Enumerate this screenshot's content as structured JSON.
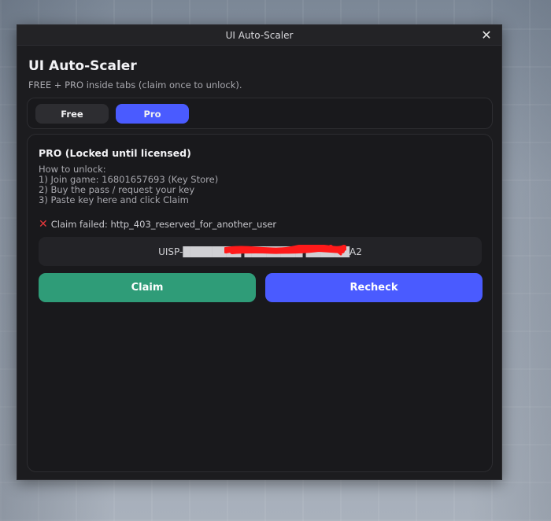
{
  "window": {
    "title": "UI Auto-Scaler",
    "close_glyph": "✕"
  },
  "app": {
    "title": "UI Auto-Scaler",
    "subtitle": "FREE + PRO inside tabs (claim once to unlock)."
  },
  "tabs": [
    {
      "label": "Free",
      "active": false
    },
    {
      "label": "Pro",
      "active": true
    }
  ],
  "pro_panel": {
    "heading": "PRO (Locked until licensed)",
    "instructions": [
      "How to unlock:",
      "1) Join game: 16801657693 (Key Store)",
      "2) Buy the pass / request your key",
      "3) Paste key here and click Claim"
    ],
    "status_icon": "x-icon",
    "status_text": "Claim failed: http_403_reserved_for_another_user",
    "key_value": "UISP-████████-████████-██████A2",
    "claim_label": "Claim",
    "recheck_label": "Recheck"
  },
  "colors": {
    "accent_blue": "#4a5bff",
    "claim_green": "#2f9c78",
    "error_red": "#e5383b",
    "redaction_red": "#ff1a1a"
  }
}
